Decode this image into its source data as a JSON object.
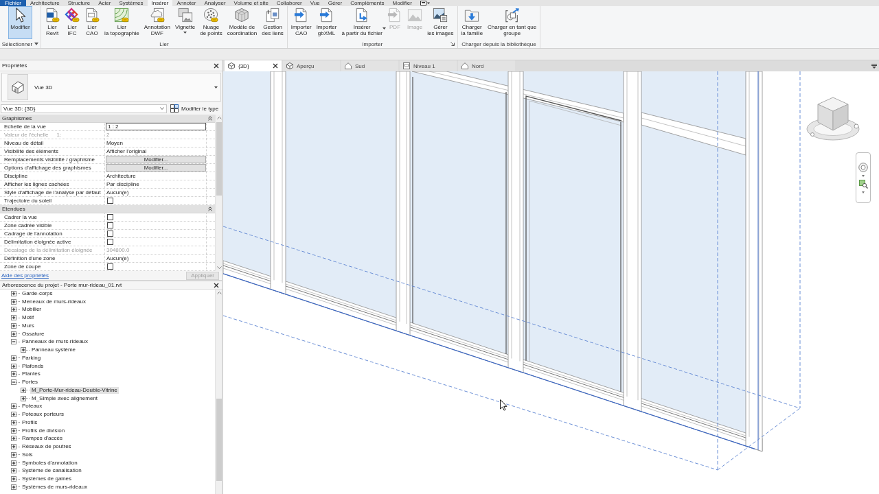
{
  "menu_tabs": [
    {
      "label": "Fichier",
      "kind": "file",
      "selected": false
    },
    {
      "label": "Architecture",
      "kind": "tab",
      "selected": false
    },
    {
      "label": "Structure",
      "kind": "tab",
      "selected": false
    },
    {
      "label": "Acier",
      "kind": "tab",
      "selected": false
    },
    {
      "label": "Systèmes",
      "kind": "tab",
      "selected": false
    },
    {
      "label": "Insérer",
      "kind": "tab",
      "selected": true
    },
    {
      "label": "Annoter",
      "kind": "tab",
      "selected": false
    },
    {
      "label": "Analyser",
      "kind": "tab",
      "selected": false
    },
    {
      "label": "Volume et site",
      "kind": "tab",
      "selected": false
    },
    {
      "label": "Collaborer",
      "kind": "tab",
      "selected": false
    },
    {
      "label": "Vue",
      "kind": "tab",
      "selected": false
    },
    {
      "label": "Gérer",
      "kind": "tab",
      "selected": false
    },
    {
      "label": "Compléments",
      "kind": "tab",
      "selected": false
    },
    {
      "label": "Modifier",
      "kind": "tab",
      "selected": false
    }
  ],
  "ribbon": {
    "panels": [
      {
        "title": "Sélectionner",
        "dropdown": true,
        "launcher": false,
        "buttons": [
          {
            "lines": [
              "Modifier"
            ],
            "selected": true,
            "disabled": false,
            "dropdown": false
          }
        ]
      },
      {
        "title": "Lier",
        "dropdown": false,
        "launcher": false,
        "buttons": [
          {
            "lines": [
              "Lier",
              "Revit"
            ],
            "selected": false,
            "disabled": false,
            "dropdown": false
          },
          {
            "lines": [
              "Lier",
              "IFC"
            ],
            "selected": false,
            "disabled": false,
            "dropdown": false
          },
          {
            "lines": [
              "Lier",
              "CAO"
            ],
            "selected": false,
            "disabled": false,
            "dropdown": false
          },
          {
            "lines": [
              "Lier",
              "la topographie"
            ],
            "selected": false,
            "disabled": false,
            "dropdown": false
          },
          {
            "lines": [
              "Annotation",
              "DWF"
            ],
            "selected": false,
            "disabled": false,
            "dropdown": false
          },
          {
            "lines": [
              "Vignette"
            ],
            "selected": false,
            "disabled": false,
            "dropdown": true
          },
          {
            "lines": [
              "Nuage",
              "de points"
            ],
            "selected": false,
            "disabled": false,
            "dropdown": false
          },
          {
            "lines": [
              "Modèle de",
              "coordination"
            ],
            "selected": false,
            "disabled": false,
            "dropdown": false
          },
          {
            "lines": [
              "Gestion",
              "des liens"
            ],
            "selected": false,
            "disabled": false,
            "dropdown": false
          }
        ]
      },
      {
        "title": "Importer",
        "dropdown": false,
        "launcher": true,
        "buttons": [
          {
            "lines": [
              "Importer",
              "CAO"
            ],
            "selected": false,
            "disabled": false,
            "dropdown": false
          },
          {
            "lines": [
              "Importer",
              "gbXML"
            ],
            "selected": false,
            "disabled": false,
            "dropdown": false
          },
          {
            "lines": [
              "Insérer",
              "à partir du fichier"
            ],
            "selected": false,
            "disabled": false,
            "dropdown": true
          },
          {
            "lines": [
              "PDF"
            ],
            "selected": false,
            "disabled": true,
            "dropdown": false
          },
          {
            "lines": [
              "Image"
            ],
            "selected": false,
            "disabled": true,
            "dropdown": false
          },
          {
            "lines": [
              "Gérer",
              "les images"
            ],
            "selected": false,
            "disabled": false,
            "dropdown": false
          }
        ]
      },
      {
        "title": "Charger depuis la bibliothèque",
        "dropdown": false,
        "launcher": false,
        "buttons": [
          {
            "lines": [
              "Charger",
              "la famille"
            ],
            "selected": false,
            "disabled": false,
            "dropdown": false
          },
          {
            "lines": [
              "Charger en tant que",
              "groupe"
            ],
            "selected": false,
            "disabled": false,
            "dropdown": false
          }
        ]
      }
    ]
  },
  "properties": {
    "title": "Propriétés",
    "type_name": "Vue 3D",
    "instance": "Vue 3D: {3D}",
    "edit_type": "Modifier le type",
    "groups": [
      {
        "name": "Graphismes",
        "expanded": true,
        "rows": [
          {
            "label": "Echelle de la vue",
            "kind": "input",
            "value": "1 : 2",
            "disabled": false
          },
          {
            "label": "Valeur de l'échelle",
            "label_suffix": "1:",
            "kind": "text",
            "value": "2",
            "disabled": true
          },
          {
            "label": "Niveau de détail",
            "kind": "text",
            "value": "Moyen",
            "disabled": false
          },
          {
            "label": "Visibilité des éléments",
            "kind": "text",
            "value": "Afficher l'original",
            "disabled": false
          },
          {
            "label": "Remplacements visibilité / graphisme",
            "kind": "button",
            "value": "Modifier...",
            "disabled": false
          },
          {
            "label": "Options d'affichage des graphismes",
            "kind": "button",
            "value": "Modifier...",
            "disabled": false
          },
          {
            "label": "Discipline",
            "kind": "text",
            "value": "Architecture",
            "disabled": false
          },
          {
            "label": "Afficher les lignes cachées",
            "kind": "text",
            "value": "Par discipline",
            "disabled": false
          },
          {
            "label": "Style d'affichage de l'analyse par défaut",
            "kind": "text",
            "value": "Aucun(e)",
            "disabled": false
          },
          {
            "label": "Trajectoire du soleil",
            "kind": "checkbox",
            "checked": false,
            "disabled": false
          }
        ]
      },
      {
        "name": "Etendues",
        "expanded": true,
        "rows": [
          {
            "label": "Cadrer la vue",
            "kind": "checkbox",
            "checked": false,
            "disabled": false
          },
          {
            "label": "Zone cadrée visible",
            "kind": "checkbox",
            "checked": false,
            "disabled": false
          },
          {
            "label": "Cadrage de l'annotation",
            "kind": "checkbox",
            "checked": false,
            "disabled": false
          },
          {
            "label": "Délimitation éloignée active",
            "kind": "checkbox",
            "checked": false,
            "disabled": false
          },
          {
            "label": "Décalage de la délimitation éloignée",
            "kind": "text",
            "value": "304800.0",
            "disabled": true
          },
          {
            "label": "Définition d'une zone",
            "kind": "text",
            "value": "Aucun(e)",
            "disabled": false
          },
          {
            "label": "Zone de coupe",
            "kind": "checkbox",
            "checked": false,
            "disabled": false
          }
        ]
      }
    ],
    "help_link": "Aide des propriétés",
    "apply": {
      "label": "Appliquer",
      "disabled": true
    }
  },
  "project_browser": {
    "title": "Arborescence du projet - Porte mur-rideau_01.rvt",
    "items": [
      {
        "label": "Garde-corps",
        "expanded": false,
        "selected": false
      },
      {
        "label": "Meneaux de murs-rideaux",
        "expanded": false,
        "selected": false
      },
      {
        "label": "Mobilier",
        "expanded": false,
        "selected": false
      },
      {
        "label": "Motif",
        "expanded": false,
        "selected": false
      },
      {
        "label": "Murs",
        "expanded": false,
        "selected": false
      },
      {
        "label": "Ossature",
        "expanded": false,
        "selected": false
      },
      {
        "label": "Panneaux de murs-rideaux",
        "expanded": true,
        "selected": false,
        "children": [
          {
            "label": "Panneau système",
            "expanded": false,
            "selected": false
          }
        ]
      },
      {
        "label": "Parking",
        "expanded": false,
        "selected": false
      },
      {
        "label": "Plafonds",
        "expanded": false,
        "selected": false
      },
      {
        "label": "Plantes",
        "expanded": false,
        "selected": false
      },
      {
        "label": "Portes",
        "expanded": true,
        "selected": false,
        "children": [
          {
            "label": "M_Porte-Mur-rideau-Double-Vitrine",
            "expanded": false,
            "selected": true
          },
          {
            "label": "M_Simple avec alignement",
            "expanded": false,
            "selected": false
          }
        ]
      },
      {
        "label": "Poteaux",
        "expanded": false,
        "selected": false
      },
      {
        "label": "Poteaux porteurs",
        "expanded": false,
        "selected": false
      },
      {
        "label": "Profils",
        "expanded": false,
        "selected": false
      },
      {
        "label": "Profils de division",
        "expanded": false,
        "selected": false
      },
      {
        "label": "Rampes d'accès",
        "expanded": false,
        "selected": false
      },
      {
        "label": "Réseaux de poutres",
        "expanded": false,
        "selected": false
      },
      {
        "label": "Sols",
        "expanded": false,
        "selected": false
      },
      {
        "label": "Symboles d'annotation",
        "expanded": false,
        "selected": false
      },
      {
        "label": "Système de canalisation",
        "expanded": false,
        "selected": false
      },
      {
        "label": "Systèmes de gaines",
        "expanded": false,
        "selected": false
      },
      {
        "label": "Systèmes de murs-rideaux",
        "expanded": false,
        "selected": false
      }
    ]
  },
  "view": {
    "tabs": [
      {
        "label": "{3D}",
        "kind": "perspective",
        "selected": true
      },
      {
        "label": "Aperçu",
        "kind": "perspective",
        "selected": false
      },
      {
        "label": "Sud",
        "kind": "elevation",
        "selected": false
      },
      {
        "label": "Niveau 1",
        "kind": "plan",
        "selected": false
      },
      {
        "label": "Nord",
        "kind": "elevation",
        "selected": false
      }
    ]
  }
}
